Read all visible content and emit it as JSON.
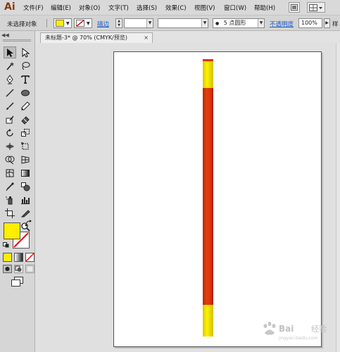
{
  "app": {
    "logo": "Ai"
  },
  "menu": {
    "items": [
      "文件(F)",
      "编辑(E)",
      "对象(O)",
      "文字(T)",
      "选择(S)",
      "效果(C)",
      "视图(V)",
      "窗口(W)",
      "帮助(H)"
    ]
  },
  "control_bar": {
    "selection_label": "未选择对象",
    "fill_color": "#ffee00",
    "stroke_label": "描边",
    "stroke_width_value": "",
    "brush_value": "",
    "point_label": "5 点圆形",
    "opacity_label": "不透明度",
    "opacity_value": "100%",
    "overflow_label": "样"
  },
  "document": {
    "tab_title": "未标题-3* @ 70% (CMYK/预览)",
    "close_glyph": "×"
  },
  "tools_panel": {
    "fill_color": "#ffee00",
    "stroke_color": "none"
  },
  "artwork": {
    "colors": {
      "yellow": "#f2e600",
      "red": "#e0350c",
      "red_dark": "#b32405"
    }
  },
  "watermark": {
    "text": "Baidu 经验",
    "subtext": "jingyan.baidu.com"
  }
}
